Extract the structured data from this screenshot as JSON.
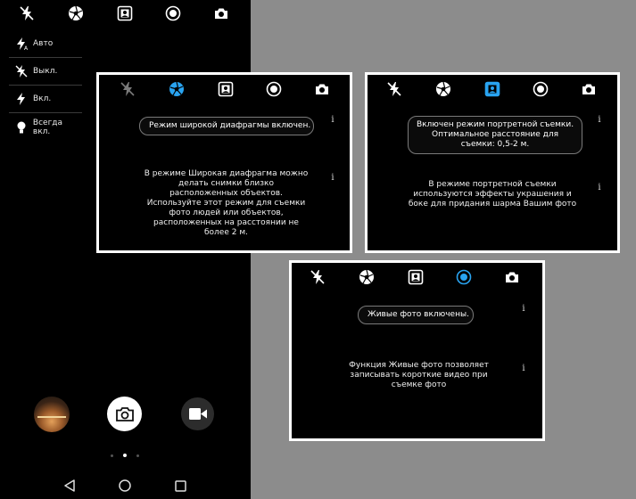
{
  "colors": {
    "accent": "#29a3f0",
    "icon": "#ffffff",
    "inactive": "#7a7a7a"
  },
  "mode_icons": [
    "flash-off-icon",
    "aperture-icon",
    "portrait-icon",
    "live-photo-icon",
    "switch-camera-icon"
  ],
  "flash_menu": {
    "items": [
      {
        "icon": "flash-auto-icon",
        "label": "Авто"
      },
      {
        "icon": "flash-off-icon",
        "label": "Выкл."
      },
      {
        "icon": "flash-on-icon",
        "label": "Вкл."
      },
      {
        "icon": "torch-icon",
        "label": "Всегда вкл."
      }
    ]
  },
  "camera_controls": {
    "gallery": "gallery-thumbnail",
    "shutter": "camera-icon",
    "video": "video-camera-icon",
    "pages": {
      "count": 3,
      "active": 1
    }
  },
  "nav": [
    "back-icon",
    "home-icon",
    "recents-icon"
  ],
  "panels": {
    "wide_aperture": {
      "active_mode": "aperture",
      "banner": "Режим широкой диафрагмы включен.",
      "description": "В режиме Широкая диафрагма можно делать снимки близко расположенных объектов. Используйте этот режим для съемки фото людей или объектов, расположенных на расстоянии не более 2 м.",
      "info": "i"
    },
    "portrait": {
      "active_mode": "portrait",
      "banner": "Включен режим портретной съемки. Оптимальное расстояние для съемки: 0,5-2 м.",
      "description": "В режиме портретной съемки используются эффекты украшения и боке для придания шарма Вашим фото",
      "info": "i"
    },
    "live_photo": {
      "active_mode": "live",
      "banner": "Живые фото включены.",
      "description": "Функция Живые фото позволяет записывать короткие видео при съемке фото",
      "info": "i"
    }
  }
}
